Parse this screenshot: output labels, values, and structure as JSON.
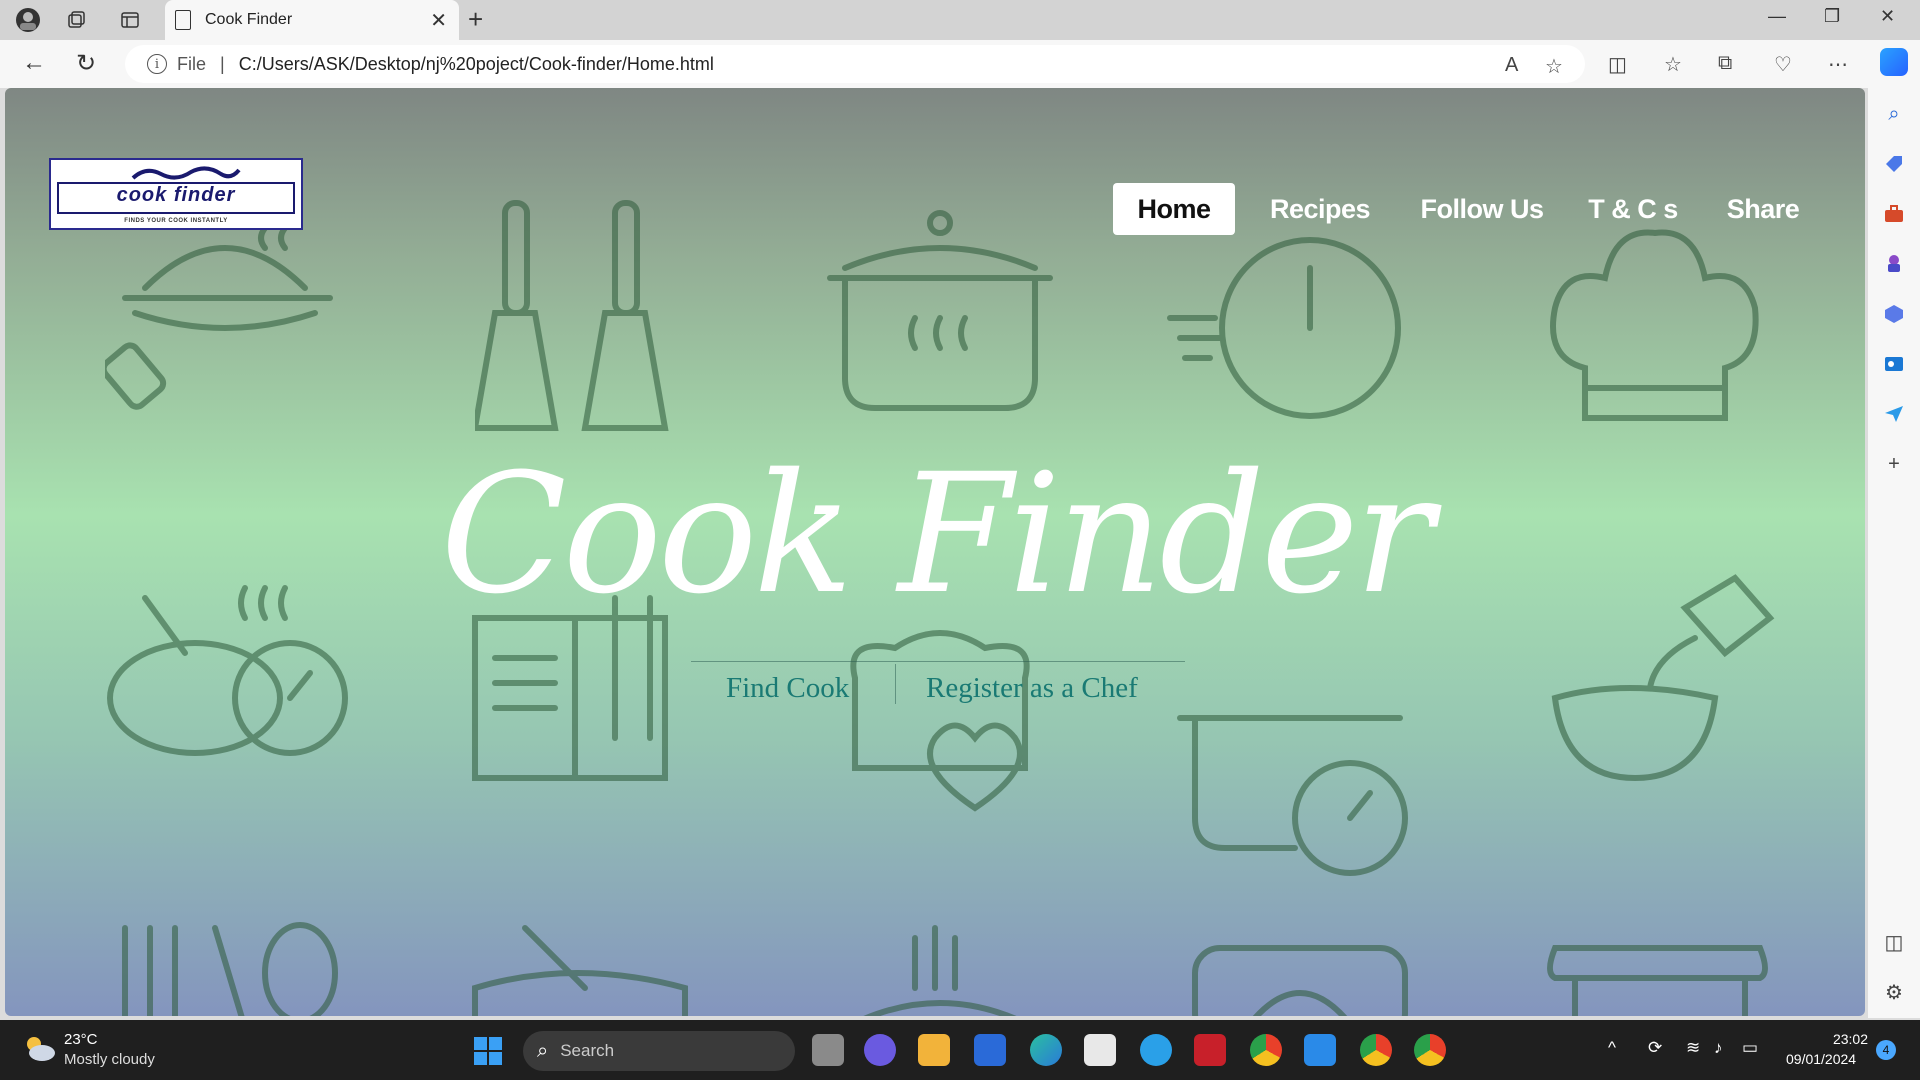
{
  "browser": {
    "tab_title": "Cook Finder",
    "url_label": "File",
    "url": "C:/Users/ASK/Desktop/nj%20poject/Cook-finder/Home.html"
  },
  "page": {
    "logo": {
      "name": "cook finder",
      "tagline": "FINDS YOUR COOK INSTANTLY"
    },
    "menu": [
      {
        "label": "Home",
        "active": true
      },
      {
        "label": "Recipes",
        "active": false
      },
      {
        "label": "Follow Us",
        "active": false
      },
      {
        "label": "T & C s",
        "active": false
      },
      {
        "label": "Share",
        "active": false
      }
    ],
    "hero_title": "Cook Finder",
    "links": {
      "find_cook": "Find Cook",
      "register": "Register as a Chef"
    }
  },
  "taskbar": {
    "temperature": "23°C",
    "weather": "Mostly cloudy",
    "search_label": "Search",
    "time": "23:02",
    "date": "09/01/2024",
    "notifications": "4"
  },
  "colors": {
    "link": "#1a7a74",
    "menu_active_bg": "#ffffff",
    "taskbar": "#1f1f1f"
  }
}
